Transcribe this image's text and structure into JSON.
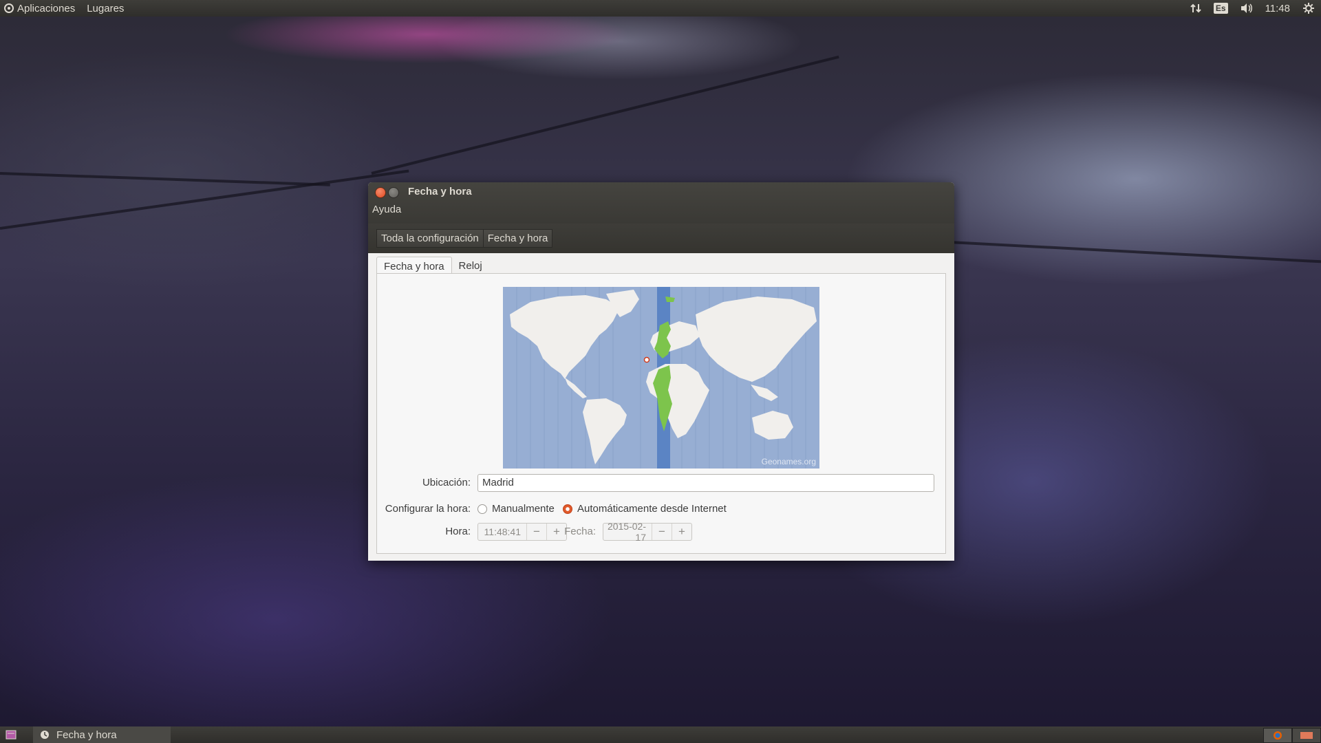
{
  "top_panel": {
    "applications": "Aplicaciones",
    "places": "Lugares",
    "keyboard_layout": "Es",
    "clock": "11:48"
  },
  "window": {
    "title": "Fecha y hora",
    "menu_help": "Ayuda",
    "breadcrumbs": [
      "Toda la configuración",
      "Fecha y hora"
    ],
    "tabs": [
      "Fecha y hora",
      "Reloj"
    ],
    "map_credit": "Geonames.org",
    "location": {
      "label": "Ubicación:",
      "value": "Madrid"
    },
    "set_time": {
      "label": "Configurar la hora:",
      "manual": "Manualmente",
      "auto": "Automáticamente desde Internet",
      "selected": "auto"
    },
    "time": {
      "label": "Hora:",
      "value": "11:48:41",
      "minus": "−",
      "plus": "+"
    },
    "date": {
      "label": "Fecha:",
      "value": "2015-02-17",
      "minus": "−",
      "plus": "+"
    }
  },
  "bottom_panel": {
    "task": "Fecha y hora"
  },
  "colors": {
    "accent": "#e05a2b",
    "panel": "#3c3b37",
    "timezone_highlight": "#7dc44c",
    "ocean": "#97aed3"
  }
}
